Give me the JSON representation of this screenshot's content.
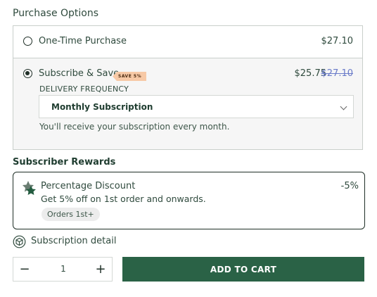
{
  "section_title": "Purchase Options",
  "one_time": {
    "label": "One-Time Purchase",
    "price": "$27.10"
  },
  "subscribe": {
    "label": "Subscribe & Save",
    "badge": "SAVE 5%",
    "price": "$25.75",
    "old_price": "$27.10",
    "frequency_label": "DELIVERY FREQUENCY",
    "frequency_selected": "Monthly Subscription",
    "helper": "You'll receive your subscription every month."
  },
  "rewards": {
    "title": "Subscriber Rewards",
    "name": "Percentage Discount",
    "description": "Get 5% off on 1st order and onwards.",
    "value": "-5%",
    "chip": "Orders 1st+"
  },
  "subscription_detail": "Subscription detail",
  "quantity": {
    "minus": "−",
    "value": "1",
    "plus": "+"
  },
  "add_to_cart": "ADD TO CART",
  "colors": {
    "accent": "#2a6246",
    "badge": "#f7c9a6",
    "old_price": "#6a7bc9"
  },
  "icons": [
    "radio-unchecked",
    "radio-checked",
    "chevron-down-icon",
    "star-badge-icon",
    "box-cycle-icon",
    "minus-icon",
    "plus-icon"
  ]
}
